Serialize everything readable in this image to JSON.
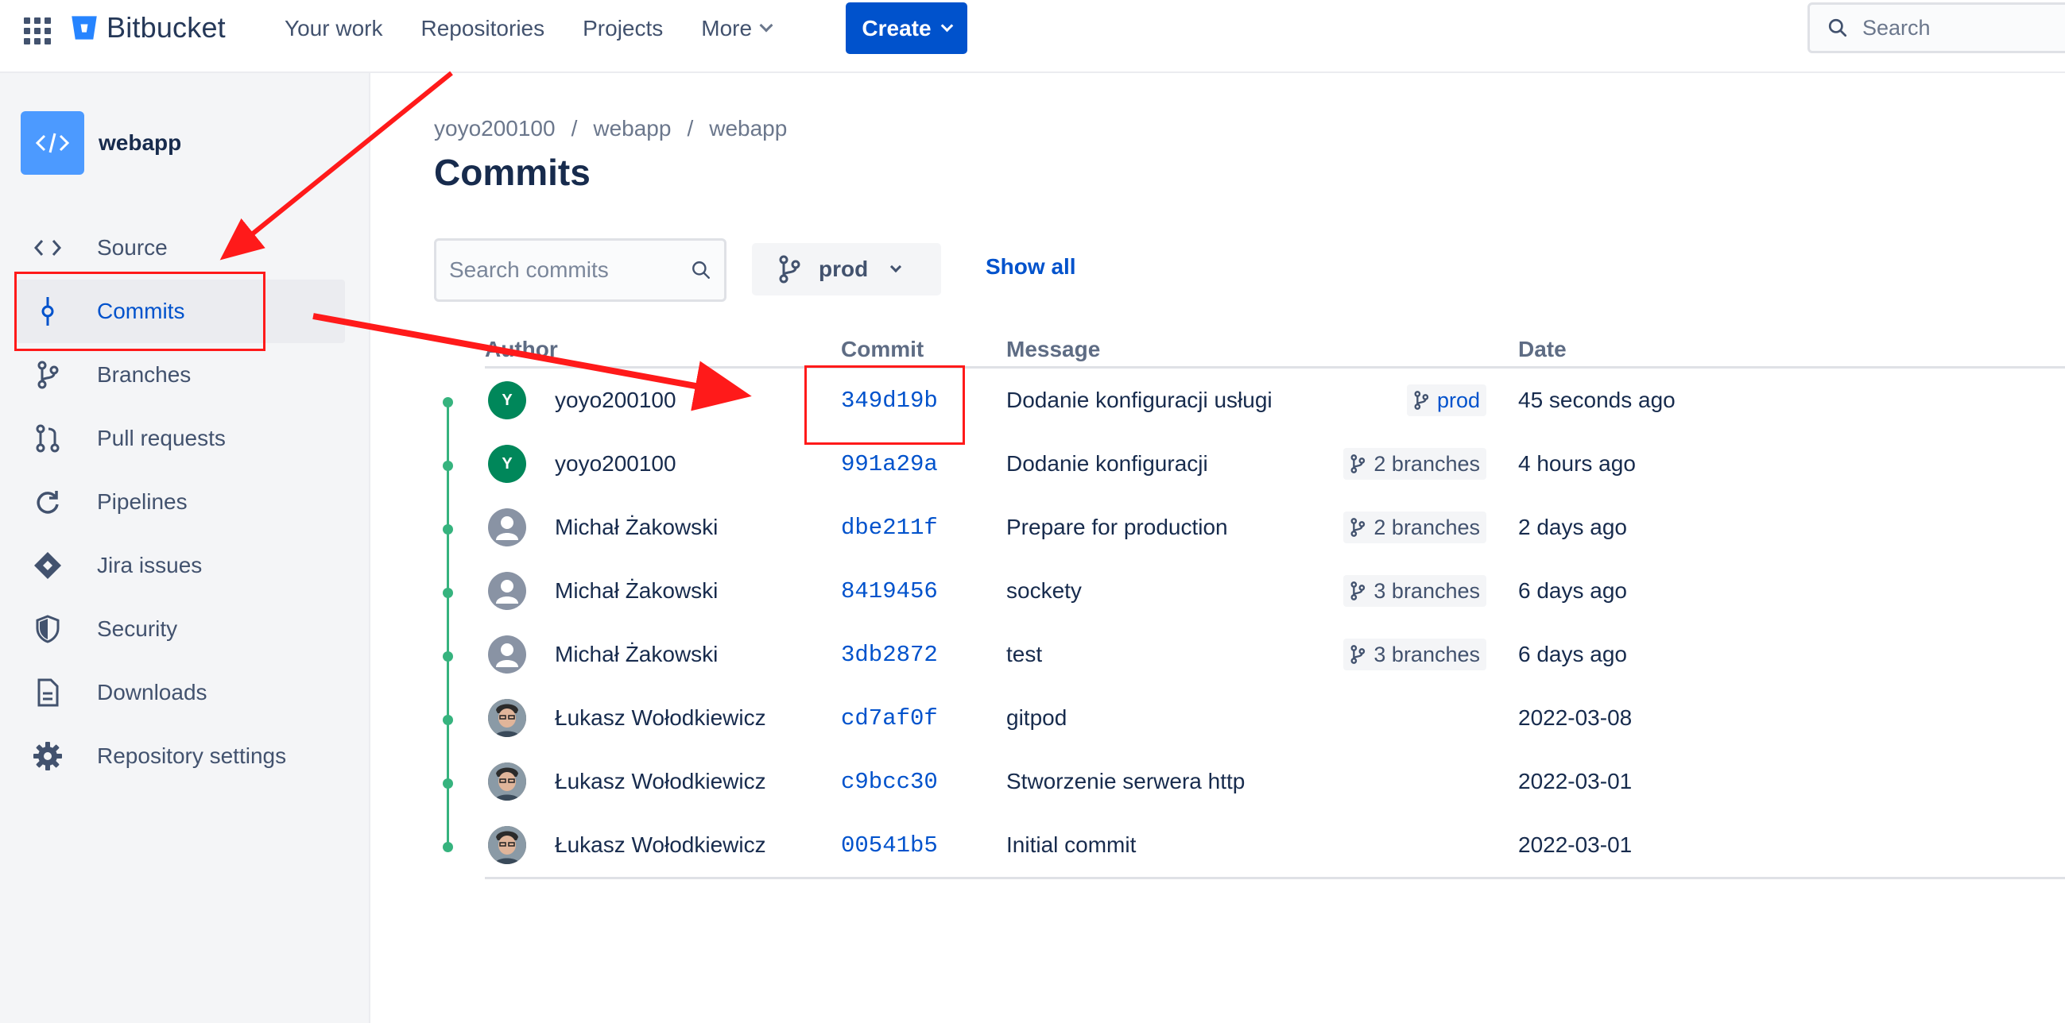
{
  "topbar": {
    "brand": "Bitbucket",
    "nav": [
      {
        "label": "Your work"
      },
      {
        "label": "Repositories"
      },
      {
        "label": "Projects"
      },
      {
        "label": "More"
      }
    ],
    "create_label": "Create",
    "search_placeholder": "Search"
  },
  "sidebar": {
    "repo_name": "webapp",
    "items": [
      {
        "label": "Source",
        "icon": "code-icon"
      },
      {
        "label": "Commits",
        "icon": "commit-icon",
        "active": true
      },
      {
        "label": "Branches",
        "icon": "branch-icon"
      },
      {
        "label": "Pull requests",
        "icon": "pull-request-icon"
      },
      {
        "label": "Pipelines",
        "icon": "pipelines-icon"
      },
      {
        "label": "Jira issues",
        "icon": "jira-icon"
      },
      {
        "label": "Security",
        "icon": "shield-icon"
      },
      {
        "label": "Downloads",
        "icon": "file-icon"
      },
      {
        "label": "Repository settings",
        "icon": "gear-icon"
      }
    ]
  },
  "main": {
    "breadcrumb": [
      "yoyo200100",
      "webapp",
      "webapp"
    ],
    "breadcrumb_sep": "/",
    "title": "Commits",
    "search_placeholder": "Search commits",
    "branch": "prod",
    "show_all": "Show all",
    "columns": {
      "author": "Author",
      "commit": "Commit",
      "message": "Message",
      "date": "Date"
    },
    "commits": [
      {
        "author": "yoyo200100",
        "avatar": "Y",
        "avatar_type": "letter",
        "hash": "349d19b",
        "message": "Dodanie konfiguracji usługi",
        "branches": "prod",
        "date": "45 seconds ago"
      },
      {
        "author": "yoyo200100",
        "avatar": "Y",
        "avatar_type": "letter",
        "hash": "991a29a",
        "message": "Dodanie konfiguracji",
        "branches": "2 branches",
        "date": "4 hours ago"
      },
      {
        "author": "Michał Żakowski",
        "avatar": "",
        "avatar_type": "default",
        "hash": "dbe211f",
        "message": "Prepare for production",
        "branches": "2 branches",
        "date": "2 days ago"
      },
      {
        "author": "Michał Żakowski",
        "avatar": "",
        "avatar_type": "default",
        "hash": "8419456",
        "message": "sockety",
        "branches": "3 branches",
        "date": "6 days ago"
      },
      {
        "author": "Michał Żakowski",
        "avatar": "",
        "avatar_type": "default",
        "hash": "3db2872",
        "message": "test",
        "branches": "3 branches",
        "date": "6 days ago"
      },
      {
        "author": "Łukasz Wołodkiewicz",
        "avatar": "",
        "avatar_type": "photo",
        "hash": "cd7af0f",
        "message": "gitpod",
        "branches": "",
        "date": "2022-03-08"
      },
      {
        "author": "Łukasz Wołodkiewicz",
        "avatar": "",
        "avatar_type": "photo",
        "hash": "c9bcc30",
        "message": "Stworzenie serwera http",
        "branches": "",
        "date": "2022-03-01"
      },
      {
        "author": "Łukasz Wołodkiewicz",
        "avatar": "",
        "avatar_type": "photo",
        "hash": "00541b5",
        "message": "Initial commit",
        "branches": "",
        "date": "2022-03-01"
      }
    ]
  },
  "colors": {
    "accent": "#0052cc",
    "graph": "#36b37e",
    "annotation": "#ff1a1a"
  }
}
